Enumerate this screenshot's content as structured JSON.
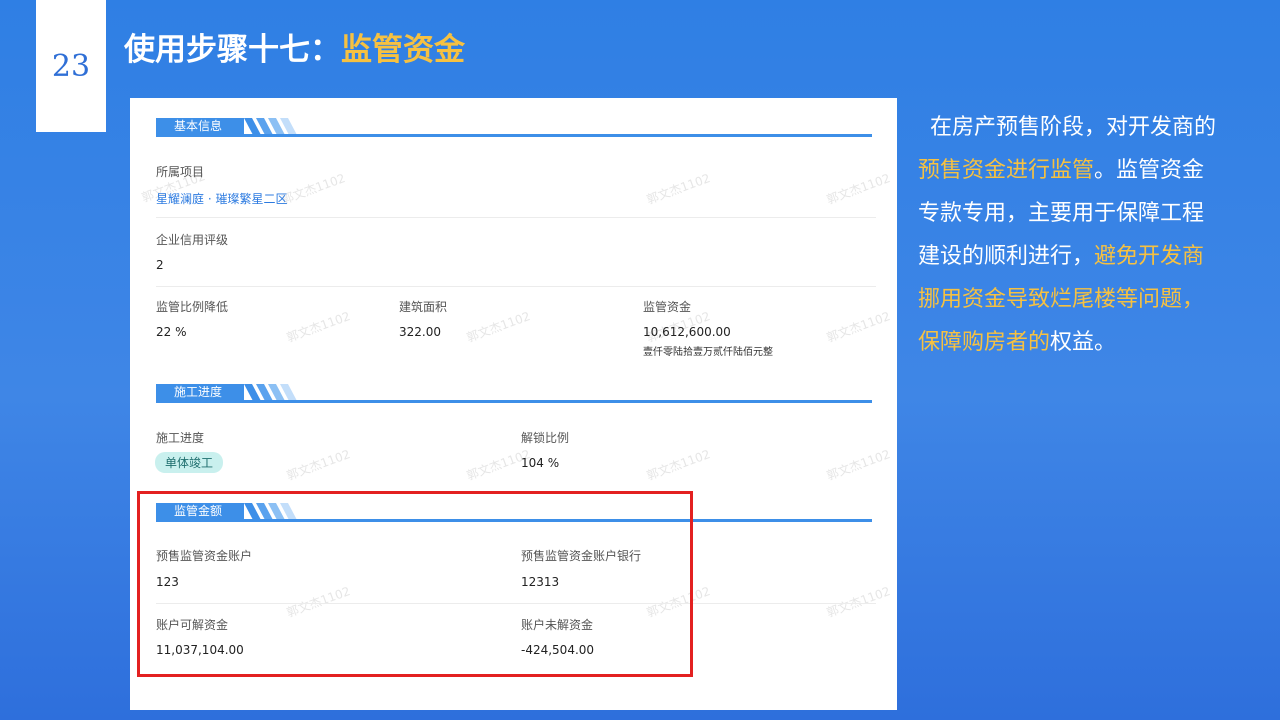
{
  "page_number": "23",
  "title": {
    "prefix": "使用步骤十七：",
    "accent": "监管资金"
  },
  "description": {
    "part1": "在房产预售阶段，对开发商的",
    "accent1": "预售资金进行监管",
    "part2": "。监管资金专款专用，主要用于保障工程建设的顺利进行，",
    "accent2": "避免开发商挪用资金导致烂尾楼等问题，保障购房者的",
    "part3": "权益。"
  },
  "watermark": "郭文杰1102",
  "basic_info": {
    "header": "基本信息",
    "project_label": "所属项目",
    "project_value": "星耀澜庭 · 璀璨繁星二区",
    "credit_label": "企业信用评级",
    "credit_value": "2",
    "ratio_label": "监管比例降低",
    "ratio_value": "22 %",
    "area_label": "建筑面积",
    "area_value": "322.00",
    "funds_label": "监管资金",
    "funds_value": "10,612,600.00",
    "funds_words": "壹仟零陆拾壹万贰仟陆佰元整"
  },
  "progress": {
    "header": "施工进度",
    "progress_label": "施工进度",
    "progress_value": "单体竣工",
    "unlock_label": "解锁比例",
    "unlock_value": "104 %"
  },
  "amount": {
    "header": "监管金额",
    "account_label": "预售监管资金账户",
    "account_value": "123",
    "bank_label": "预售监管资金账户银行",
    "bank_value": "12313",
    "unlockable_label": "账户可解资金",
    "unlockable_value": "11,037,104.00",
    "locked_label": "账户未解资金",
    "locked_value": "-424,504.00"
  },
  "colors": {
    "accent": "#f6c141",
    "brand_blue": "#3d8fe8",
    "highlight": "#e32020"
  }
}
